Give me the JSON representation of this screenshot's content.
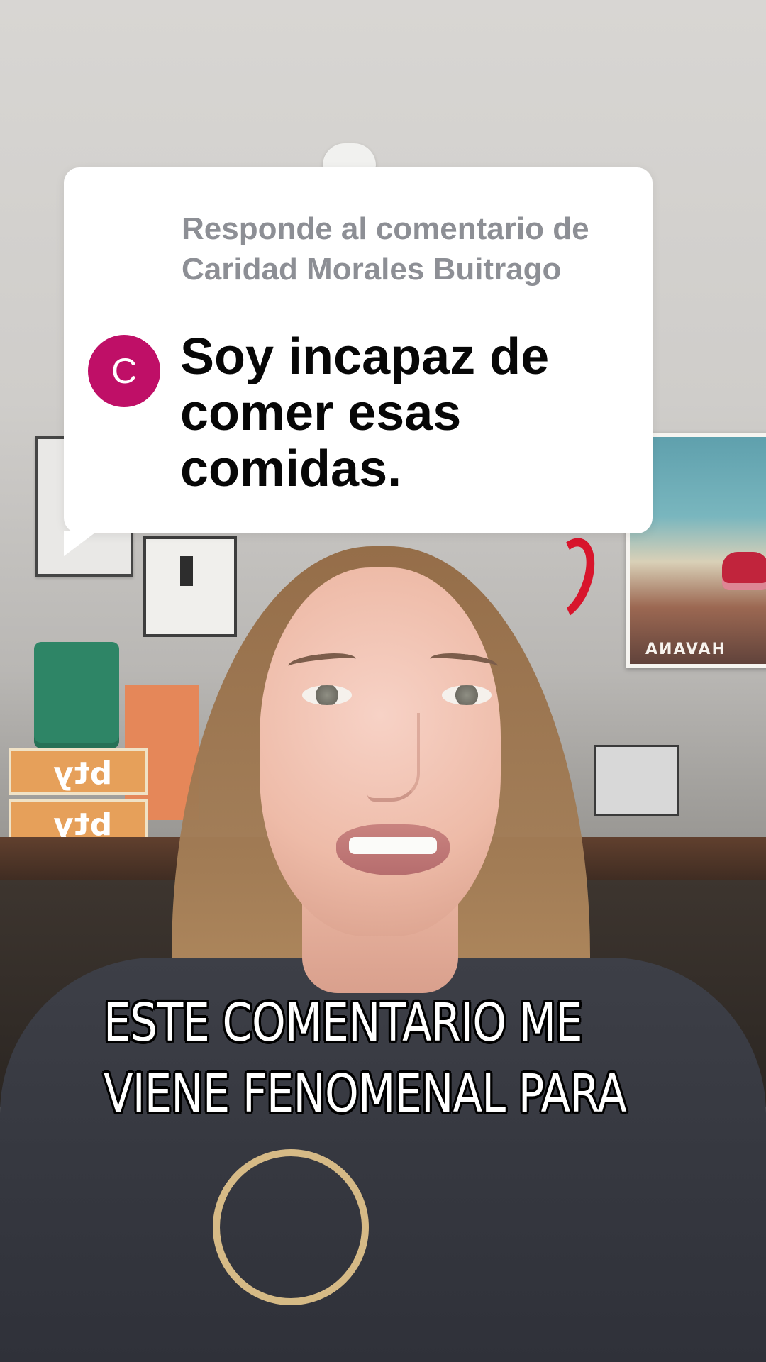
{
  "reply_card": {
    "heading": "Responde al comentario de Caridad Morales Buitrago",
    "avatar_letter": "C",
    "comment": "Soy incapaz de comer esas comidas."
  },
  "scene": {
    "poster_text": "HAVANA",
    "box_text": "bty"
  },
  "caption": {
    "line_1": "ESTE COMENTARIO ME",
    "line_2": "VIENE FENOMENAL PARA"
  },
  "colors": {
    "avatar": "#bf0f67",
    "heading": "#8d8f95",
    "comment": "#070707",
    "caption": "#ffffff",
    "caption_outline": "#000000"
  },
  "icons": {
    "avatar": "comment-author-avatar"
  }
}
